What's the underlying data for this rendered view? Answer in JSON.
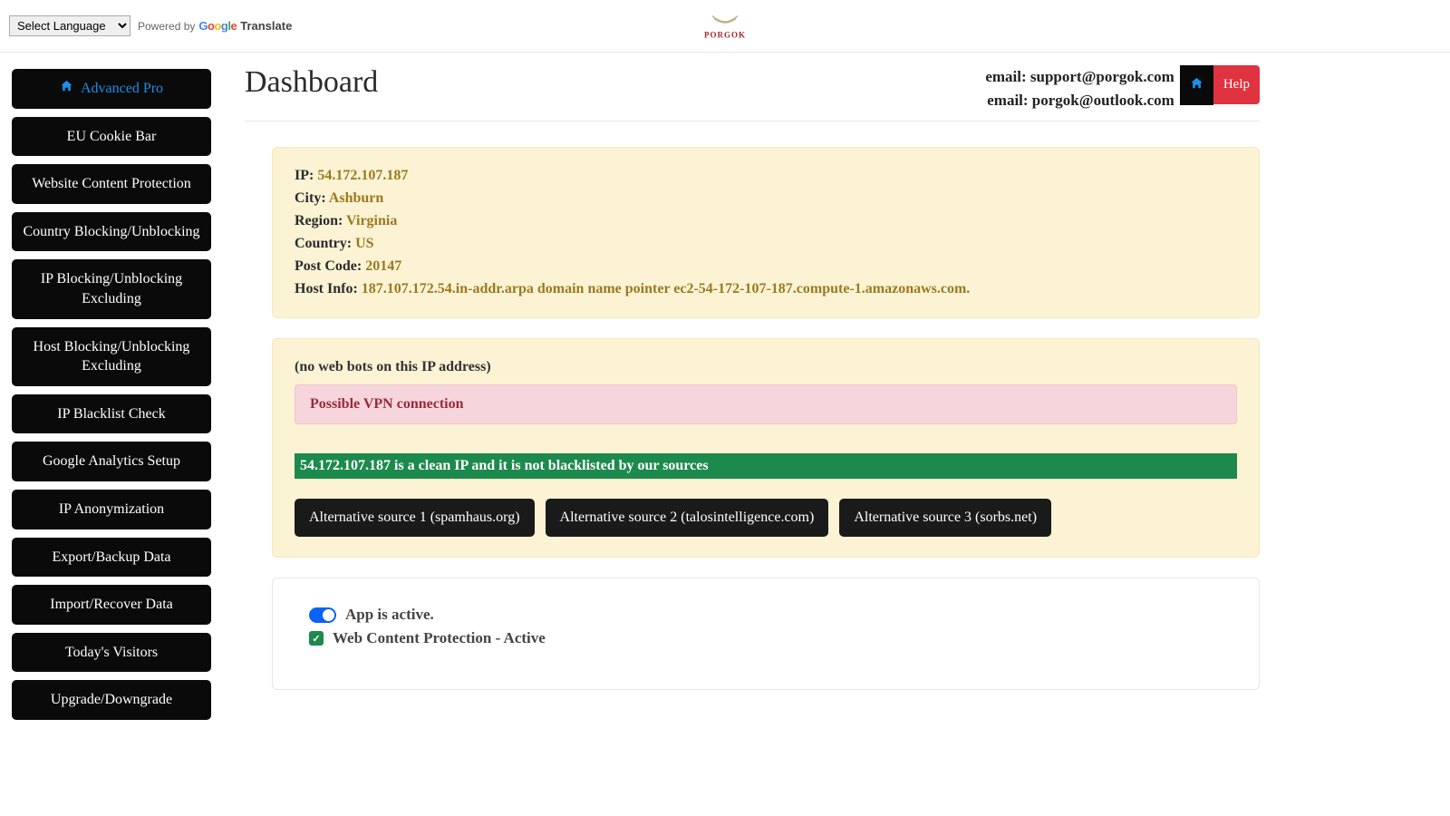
{
  "topbar": {
    "language_select": "Select Language",
    "powered_by": "Powered by",
    "translate": "Translate",
    "brand": "PORGOK"
  },
  "sidebar": {
    "items": [
      {
        "label": "Advanced Pro",
        "active": true
      },
      {
        "label": "EU Cookie Bar"
      },
      {
        "label": "Website Content Protection"
      },
      {
        "label": "Country Blocking/Unblocking"
      },
      {
        "label": "IP Blocking/Unblocking Excluding"
      },
      {
        "label": "Host Blocking/Unblocking Excluding"
      },
      {
        "label": "IP Blacklist Check"
      },
      {
        "label": "Google Analytics Setup"
      },
      {
        "label": "IP Anonymization"
      },
      {
        "label": "Export/Backup Data"
      },
      {
        "label": "Import/Recover Data"
      },
      {
        "label": "Today's Visitors"
      },
      {
        "label": "Upgrade/Downgrade"
      }
    ]
  },
  "header": {
    "title": "Dashboard",
    "email1": "email: support@porgok.com",
    "email2": "email: porgok@outlook.com",
    "help": "Help"
  },
  "ipinfo": {
    "ip_label": "IP: ",
    "ip_value": "54.172.107.187",
    "city_label": "City: ",
    "city_value": "Ashburn",
    "region_label": "Region: ",
    "region_value": "Virginia",
    "country_label": "Country: ",
    "country_value": "US",
    "postcode_label": "Post Code: ",
    "postcode_value": "20147",
    "host_label": "Host Info: ",
    "host_value": "187.107.172.54.in-addr.arpa domain name pointer ec2-54-172-107-187.compute-1.amazonaws.com."
  },
  "bots": {
    "no_bots": "(no web bots on this IP address)",
    "vpn_alert": "Possible VPN connection",
    "clean_bar": "54.172.107.187 is a clean IP and it is not blacklisted by our sources",
    "sources": [
      "Alternative source 1 (spamhaus.org)",
      "Alternative source 2 (talosintelligence.com)",
      "Alternative source 3 (sorbs.net)"
    ]
  },
  "status": {
    "app_active": "App is active.",
    "wcp_active": "Web Content Protection - Active"
  }
}
